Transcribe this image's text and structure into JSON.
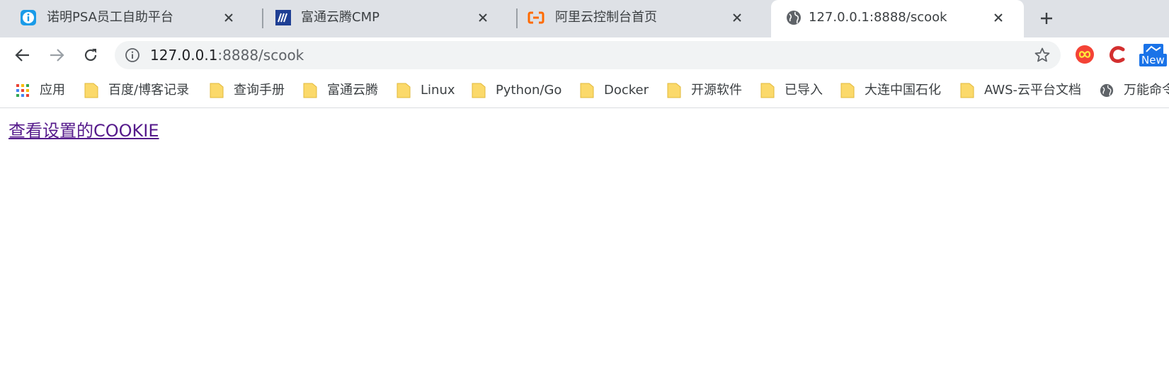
{
  "tabs": [
    {
      "title": "诺明PSA员工自助平台",
      "icon": "info-favicon-icon"
    },
    {
      "title": "富通云腾CMP",
      "icon": "ftc-favicon-icon"
    },
    {
      "title": "阿里云控制台首页",
      "icon": "aliyun-favicon-icon"
    },
    {
      "title": "127.0.0.1:8888/scook",
      "icon": "globe-icon",
      "active": true
    }
  ],
  "omnibox": {
    "host": "127.0.0.1",
    "path": ":8888/scook"
  },
  "extensions": {
    "new_badge": "New"
  },
  "bookmarks": [
    {
      "label": "应用",
      "icon": "apps-grid-icon"
    },
    {
      "label": "百度/博客记录",
      "icon": "folder-icon"
    },
    {
      "label": "查询手册",
      "icon": "folder-icon"
    },
    {
      "label": "富通云腾",
      "icon": "folder-icon"
    },
    {
      "label": "Linux",
      "icon": "folder-icon"
    },
    {
      "label": "Python/Go",
      "icon": "folder-icon"
    },
    {
      "label": "Docker",
      "icon": "folder-icon"
    },
    {
      "label": "开源软件",
      "icon": "folder-icon"
    },
    {
      "label": "已导入",
      "icon": "folder-icon"
    },
    {
      "label": "大连中国石化",
      "icon": "folder-icon"
    },
    {
      "label": "AWS-云平台文档",
      "icon": "folder-icon"
    },
    {
      "label": "万能命令",
      "icon": "globe-icon"
    }
  ],
  "page": {
    "link_text": "查看设置的COOKIE"
  },
  "colors": {
    "tabstrip": "#dee1e6",
    "visited_link": "#551a8b",
    "folder": "#fbd96a"
  }
}
